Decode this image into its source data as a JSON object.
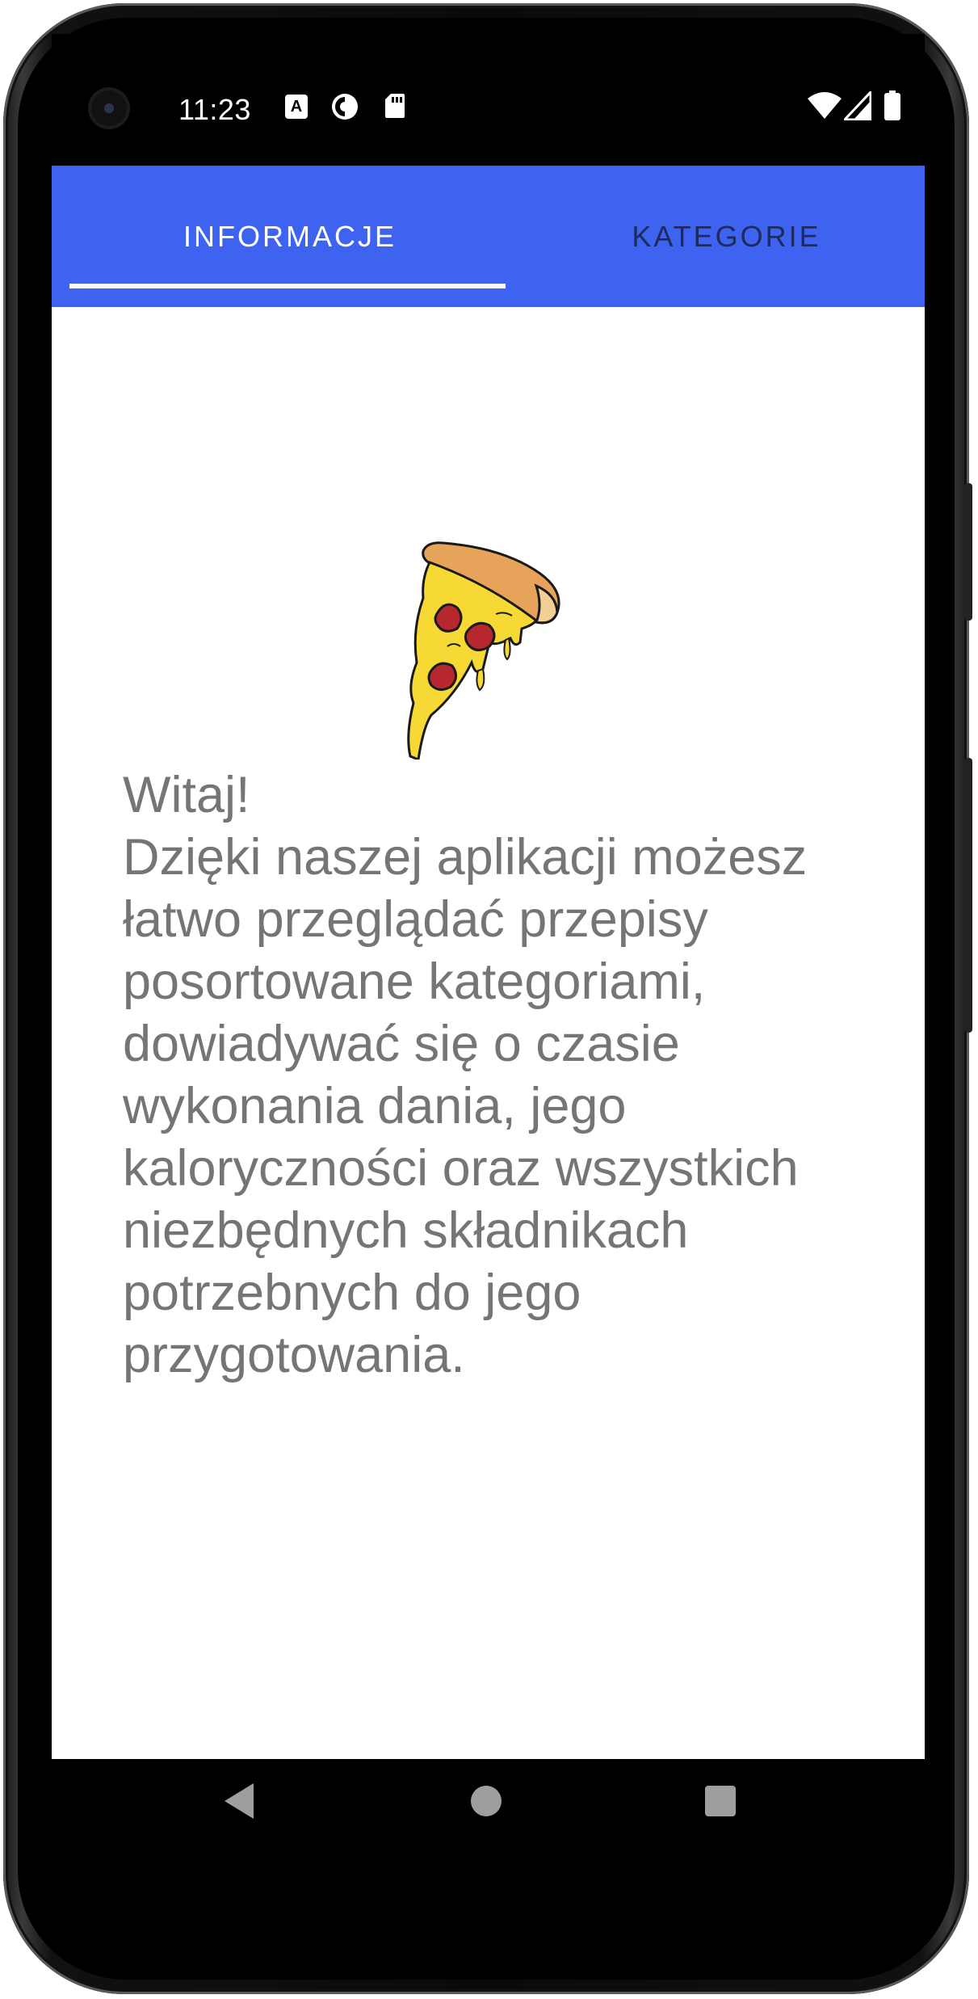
{
  "status_bar": {
    "time": "11:23",
    "icons": [
      "accessibility-a-icon",
      "data-saver-icon",
      "sd-card-icon",
      "wifi-icon",
      "signal-icon",
      "battery-icon"
    ],
    "a_icon_letter": "A"
  },
  "tabs": [
    {
      "label": "INFORMACJE",
      "selected": true
    },
    {
      "label": "KATEGORIE",
      "selected": false
    }
  ],
  "main": {
    "image": "pizza-slice-illustration",
    "lines": [
      "Witaj!",
      "Dzięki naszej aplikacji możesz",
      "łatwo przeglądać przepisy",
      "posortowane kategoriami,",
      "dowiadywać się o czasie",
      "wykonania dania, jego",
      "kaloryczności oraz wszystkich",
      "niezbędnych składnikach",
      "potrzebnych do jego",
      "przygotowania."
    ]
  },
  "nav_bar": {
    "buttons": [
      "back-icon",
      "home-icon",
      "recents-icon"
    ]
  },
  "colors": {
    "tab_bar": "#3e63f0",
    "tab_selected_text": "#ffffff",
    "tab_unselected_text": "#1d2b5c",
    "body_text": "#757575"
  }
}
